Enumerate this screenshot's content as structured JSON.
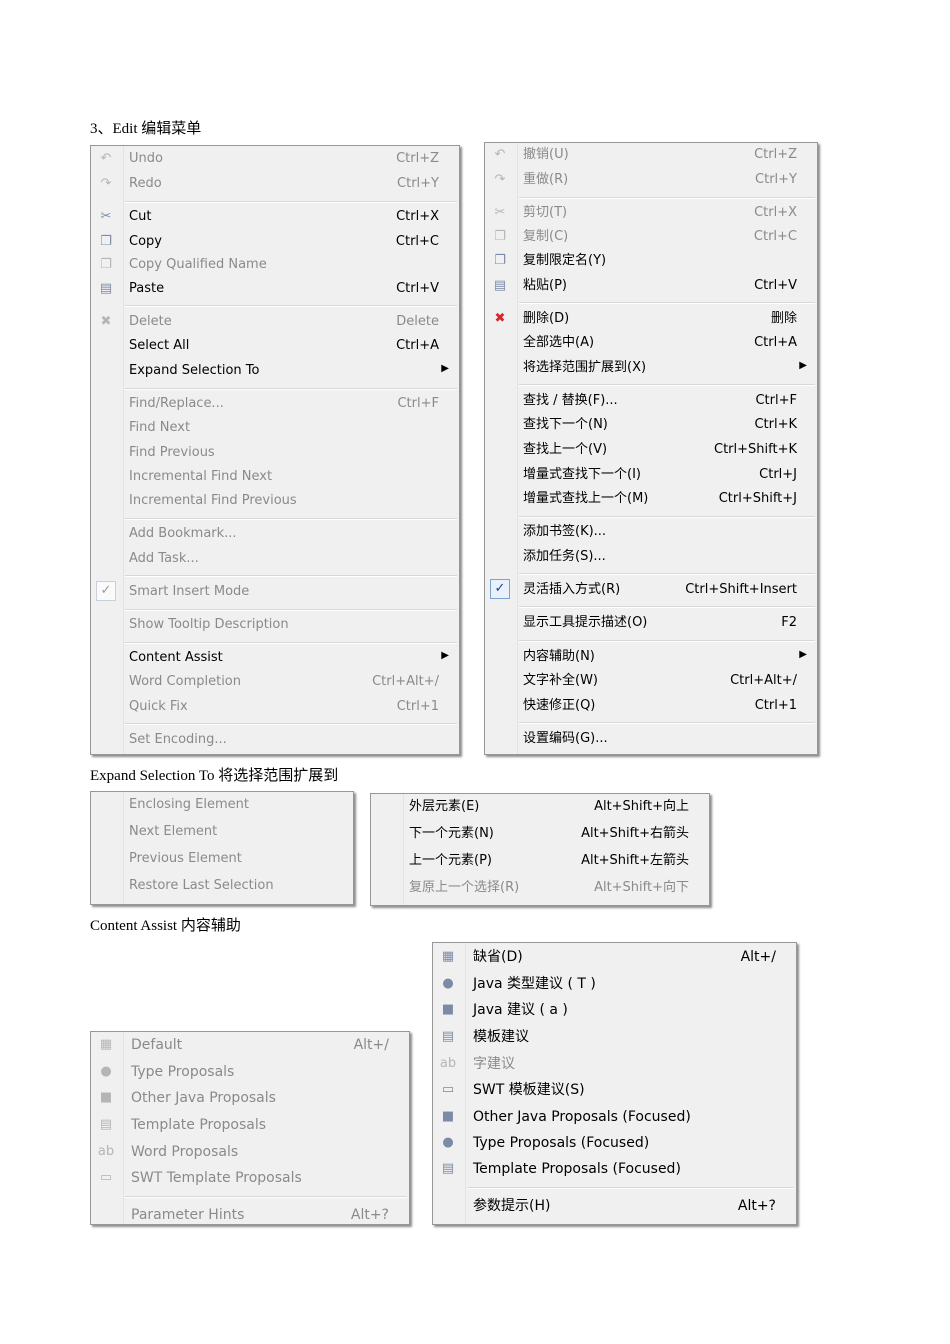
{
  "captions": {
    "edit": "3、Edit  编辑菜单",
    "expand": "Expand Selection To  将选择范围扩展到",
    "assist": "Content Assist    内容辅助"
  },
  "edit_en": [
    {
      "label": "Undo",
      "shortcut": "Ctrl+Z",
      "icon": "undo-icon",
      "glyph": "↶",
      "disabled": true
    },
    {
      "label": "Redo",
      "shortcut": "Ctrl+Y",
      "icon": "redo-icon",
      "glyph": "↷",
      "disabled": true
    },
    {
      "label": "Cut",
      "shortcut": "Ctrl+X",
      "icon": "scissors-icon",
      "glyph": "✂",
      "disabled": false
    },
    {
      "label": "Copy",
      "shortcut": "Ctrl+C",
      "icon": "copy-icon",
      "glyph": "❐",
      "disabled": false
    },
    {
      "label": "Copy Qualified Name",
      "shortcut": "",
      "icon": "copy-qualified-icon",
      "glyph": "❐",
      "disabled": true
    },
    {
      "label": "Paste",
      "shortcut": "Ctrl+V",
      "icon": "paste-icon",
      "glyph": "▤",
      "disabled": false
    },
    {
      "label": "Delete",
      "shortcut": "Delete",
      "icon": "delete-icon",
      "glyph": "✖",
      "disabled": true
    },
    {
      "label": "Select All",
      "shortcut": "Ctrl+A",
      "icon": "",
      "glyph": "",
      "disabled": false
    },
    {
      "label": "Expand Selection To",
      "shortcut": "",
      "icon": "",
      "glyph": "",
      "disabled": false,
      "submenu": true
    },
    {
      "label": "Find/Replace...",
      "shortcut": "Ctrl+F",
      "icon": "",
      "glyph": "",
      "disabled": true
    },
    {
      "label": "Find Next",
      "shortcut": "",
      "icon": "",
      "glyph": "",
      "disabled": true
    },
    {
      "label": "Find Previous",
      "shortcut": "",
      "icon": "",
      "glyph": "",
      "disabled": true
    },
    {
      "label": "Incremental Find Next",
      "shortcut": "",
      "icon": "",
      "glyph": "",
      "disabled": true
    },
    {
      "label": "Incremental Find Previous",
      "shortcut": "",
      "icon": "",
      "glyph": "",
      "disabled": true
    },
    {
      "label": "Add Bookmark...",
      "shortcut": "",
      "icon": "",
      "glyph": "",
      "disabled": true
    },
    {
      "label": "Add Task...",
      "shortcut": "",
      "icon": "",
      "glyph": "",
      "disabled": true
    },
    {
      "label": "Smart Insert Mode",
      "shortcut": "",
      "icon": "check-icon",
      "glyph": "✓",
      "disabled": true,
      "check": true
    },
    {
      "label": "Show Tooltip Description",
      "shortcut": "",
      "icon": "",
      "glyph": "",
      "disabled": true
    },
    {
      "label": "Content Assist",
      "shortcut": "",
      "icon": "",
      "glyph": "",
      "disabled": false,
      "submenu": true
    },
    {
      "label": "Word Completion",
      "shortcut": "Ctrl+Alt+/",
      "icon": "",
      "glyph": "",
      "disabled": true
    },
    {
      "label": "Quick Fix",
      "shortcut": "Ctrl+1",
      "icon": "",
      "glyph": "",
      "disabled": true
    },
    {
      "label": "Set Encoding...",
      "shortcut": "",
      "icon": "",
      "glyph": "",
      "disabled": true
    }
  ],
  "edit_zh": [
    {
      "label": "撤销(U)",
      "shortcut": "Ctrl+Z",
      "icon": "undo-icon",
      "glyph": "↶",
      "disabled": true
    },
    {
      "label": "重做(R)",
      "shortcut": "Ctrl+Y",
      "icon": "redo-icon",
      "glyph": "↷",
      "disabled": true
    },
    {
      "label": "剪切(T)",
      "shortcut": "Ctrl+X",
      "icon": "scissors-icon",
      "glyph": "✂",
      "disabled": true
    },
    {
      "label": "复制(C)",
      "shortcut": "Ctrl+C",
      "icon": "copy-icon",
      "glyph": "❐",
      "disabled": true
    },
    {
      "label": "复制限定名(Y)",
      "shortcut": "",
      "icon": "copy-qualified-icon",
      "glyph": "❐",
      "disabled": false
    },
    {
      "label": "粘贴(P)",
      "shortcut": "Ctrl+V",
      "icon": "paste-icon",
      "glyph": "▤",
      "disabled": false
    },
    {
      "label": "删除(D)",
      "shortcut": "删除",
      "icon": "delete-icon",
      "glyph": "✖",
      "disabled": false,
      "red": true
    },
    {
      "label": "全部选中(A)",
      "shortcut": "Ctrl+A",
      "icon": "",
      "glyph": "",
      "disabled": false
    },
    {
      "label": "将选择范围扩展到(X)",
      "shortcut": "",
      "icon": "",
      "glyph": "",
      "disabled": false,
      "submenu": true
    },
    {
      "label": "查找 / 替换(F)...",
      "shortcut": "Ctrl+F",
      "icon": "",
      "glyph": "",
      "disabled": false
    },
    {
      "label": "查找下一个(N)",
      "shortcut": "Ctrl+K",
      "icon": "",
      "glyph": "",
      "disabled": false
    },
    {
      "label": "查找上一个(V)",
      "shortcut": "Ctrl+Shift+K",
      "icon": "",
      "glyph": "",
      "disabled": false
    },
    {
      "label": "增量式查找下一个(I)",
      "shortcut": "Ctrl+J",
      "icon": "",
      "glyph": "",
      "disabled": false
    },
    {
      "label": "增量式查找上一个(M)",
      "shortcut": "Ctrl+Shift+J",
      "icon": "",
      "glyph": "",
      "disabled": false
    },
    {
      "label": "添加书签(K)...",
      "shortcut": "",
      "icon": "",
      "glyph": "",
      "disabled": false
    },
    {
      "label": "添加任务(S)...",
      "shortcut": "",
      "icon": "",
      "glyph": "",
      "disabled": false
    },
    {
      "label": "灵活插入方式(R)",
      "shortcut": "Ctrl+Shift+Insert",
      "icon": "check-icon",
      "glyph": "✓",
      "disabled": false,
      "check": true
    },
    {
      "label": "显示工具提示描述(O)",
      "shortcut": "F2",
      "icon": "",
      "glyph": "",
      "disabled": false
    },
    {
      "label": "内容辅助(N)",
      "shortcut": "",
      "icon": "",
      "glyph": "",
      "disabled": false,
      "submenu": true
    },
    {
      "label": "文字补全(W)",
      "shortcut": "Ctrl+Alt+/",
      "icon": "",
      "glyph": "",
      "disabled": false
    },
    {
      "label": "快速修正(Q)",
      "shortcut": "Ctrl+1",
      "icon": "",
      "glyph": "",
      "disabled": false
    },
    {
      "label": "设置编码(G)...",
      "shortcut": "",
      "icon": "",
      "glyph": "",
      "disabled": false
    }
  ],
  "expand_en": [
    {
      "label": "Enclosing Element",
      "shortcut": "",
      "disabled": true
    },
    {
      "label": "Next Element",
      "shortcut": "",
      "disabled": true
    },
    {
      "label": "Previous Element",
      "shortcut": "",
      "disabled": true
    },
    {
      "label": "Restore Last Selection",
      "shortcut": "",
      "disabled": true
    }
  ],
  "expand_zh": [
    {
      "label": "外层元素(E)",
      "shortcut": "Alt+Shift+向上",
      "disabled": false
    },
    {
      "label": "下一个元素(N)",
      "shortcut": "Alt+Shift+右箭头",
      "disabled": false
    },
    {
      "label": "上一个元素(P)",
      "shortcut": "Alt+Shift+左箭头",
      "disabled": false
    },
    {
      "label": "复原上一个选择(R)",
      "shortcut": "Alt+Shift+向下",
      "disabled": true
    }
  ],
  "assist_en": [
    {
      "label": "Default",
      "shortcut": "Alt+/",
      "icon": "default-proposals-icon",
      "glyph": "▦",
      "disabled": true
    },
    {
      "label": "Type Proposals",
      "shortcut": "",
      "icon": "type-proposals-icon",
      "glyph": "●",
      "disabled": true
    },
    {
      "label": "Other Java Proposals",
      "shortcut": "",
      "icon": "java-proposals-icon",
      "glyph": "■",
      "disabled": true
    },
    {
      "label": "Template Proposals",
      "shortcut": "",
      "icon": "template-icon",
      "glyph": "▤",
      "disabled": true
    },
    {
      "label": "Word Proposals",
      "shortcut": "",
      "icon": "word-proposals-icon",
      "glyph": "ab",
      "disabled": true
    },
    {
      "label": "SWT Template Proposals",
      "shortcut": "",
      "icon": "swt-icon",
      "glyph": "▭",
      "disabled": true
    },
    {
      "label": "Parameter Hints",
      "shortcut": "Alt+?",
      "icon": "",
      "glyph": "",
      "disabled": true
    }
  ],
  "assist_zh": [
    {
      "label": "缺省(D)",
      "shortcut": "Alt+/",
      "icon": "default-proposals-icon",
      "glyph": "▦",
      "disabled": false
    },
    {
      "label": "Java 类型建议 ( T )",
      "shortcut": "",
      "icon": "type-proposals-icon",
      "glyph": "●",
      "disabled": false
    },
    {
      "label": "Java 建议 ( a )",
      "shortcut": "",
      "icon": "java-proposals-icon",
      "glyph": "■",
      "disabled": false
    },
    {
      "label": "模板建议",
      "shortcut": "",
      "icon": "template-icon",
      "glyph": "▤",
      "disabled": false
    },
    {
      "label": "字建议",
      "shortcut": "",
      "icon": "word-proposals-icon",
      "glyph": "ab",
      "disabled": true
    },
    {
      "label": "SWT 模板建议(S)",
      "shortcut": "",
      "icon": "swt-icon",
      "glyph": "▭",
      "disabled": false
    },
    {
      "label": "Other Java Proposals (Focused)",
      "shortcut": "",
      "icon": "java-focused-icon",
      "glyph": "■",
      "disabled": false
    },
    {
      "label": "Type Proposals (Focused)",
      "shortcut": "",
      "icon": "type-focused-icon",
      "glyph": "●",
      "disabled": false
    },
    {
      "label": "Template Proposals (Focused)",
      "shortcut": "",
      "icon": "template-focused-icon",
      "glyph": "▤",
      "disabled": false
    },
    {
      "label": "参数提示(H)",
      "shortcut": "Alt+?",
      "icon": "",
      "glyph": "",
      "disabled": false
    }
  ]
}
